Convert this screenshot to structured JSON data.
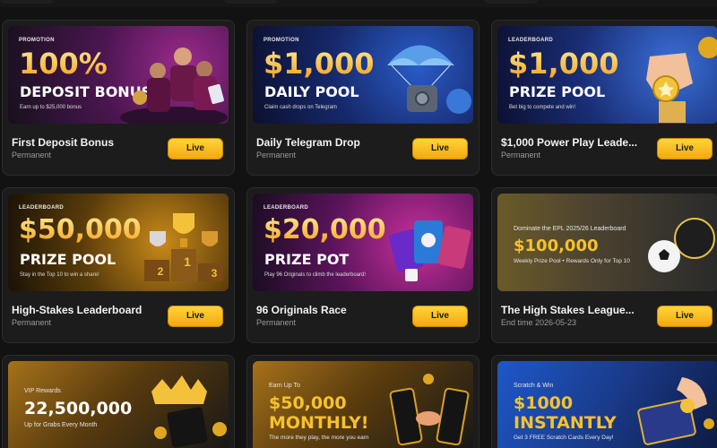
{
  "cards": [
    {
      "tag": "PROMOTION",
      "big1": "100%",
      "big2": "DEPOSIT BONUS",
      "small": "Earn up to $25,000 bonus",
      "title": "First Deposit Bonus",
      "subtitle": "Permanent",
      "button": "Live"
    },
    {
      "tag": "PROMOTION",
      "big1": "$1,000",
      "big2": "DAILY POOL",
      "small": "Claim cash drops on Telegram",
      "title": "Daily Telegram Drop",
      "subtitle": "Permanent",
      "button": "Live"
    },
    {
      "tag": "LEADERBOARD",
      "big1": "$1,000",
      "big2": "PRIZE POOL",
      "small": "Bet big to compete and win!",
      "title": "$1,000 Power Play Leade...",
      "subtitle": "Permanent",
      "button": "Live"
    },
    {
      "tag": "LEADERBOARD",
      "big1": "$50,000",
      "big2": "PRIZE POOL",
      "small": "Stay in the Top 10 to win a share!",
      "title": "High-Stakes Leaderboard",
      "subtitle": "Permanent",
      "button": "Live",
      "podium": [
        "2",
        "1",
        "3"
      ]
    },
    {
      "tag": "LEADERBOARD",
      "big1": "$20,000",
      "big2": "PRIZE POT",
      "small": "Play 96 Originals to climb the leaderboard!",
      "title": "96 Originals Race",
      "subtitle": "Permanent",
      "button": "Live"
    },
    {
      "tag": "Dominate the EPL 2025/26 Leaderboard",
      "big1": "$100,000",
      "small": "Weekly Prize Pool • Rewards Only for Top 10",
      "title": "The High Stakes League...",
      "subtitle": "End time 2026-05-23",
      "button": "Live"
    }
  ],
  "bottom_cards": [
    {
      "tag": "VIP Rewards",
      "big1": "22,500,000",
      "small": "Up for Grabs Every Month"
    },
    {
      "tag": "Earn Up To",
      "big1": "$50,000",
      "big2": "MONTHLY!",
      "small": "The more they play, the more you earn"
    },
    {
      "tag": "Scratch & Win",
      "big1": "$1000",
      "big2": "INSTANTLY",
      "small": "Get 3 FREE Scratch Cards Every Day!"
    }
  ],
  "colors": {
    "live_button": "#f4b21b",
    "card_bg": "#1c1c1c",
    "page_bg": "#121212"
  }
}
